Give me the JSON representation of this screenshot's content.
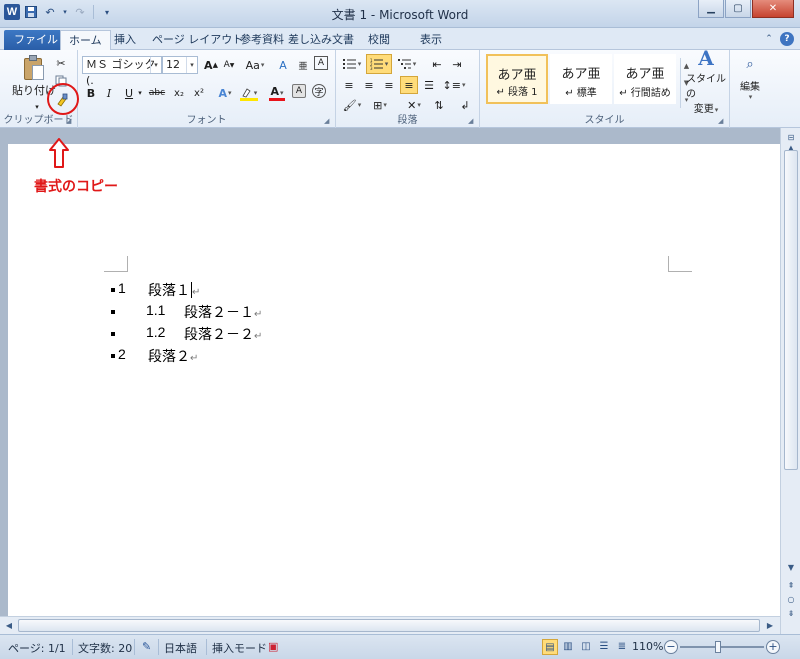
{
  "window": {
    "title": "文書 1 - Microsoft Word",
    "logo": "W"
  },
  "tabs": {
    "file": "ファイル",
    "items": [
      "ホーム",
      "挿入",
      "ページ レイアウト",
      "参考資料",
      "差し込み文書",
      "校閲",
      "表示"
    ]
  },
  "ribbon": {
    "clipboard": {
      "label": "クリップボード",
      "paste_label": "貼り付け"
    },
    "font": {
      "label": "フォント",
      "font_name": "ＭＳ ゴシック (.",
      "font_size": "12",
      "bold": "B",
      "italic": "I",
      "underline": "U",
      "strike": "abc",
      "subscript": "x₂",
      "superscript": "x²",
      "font_color": "A",
      "grow": "A",
      "shrink": "A",
      "case": "Aa",
      "clear": "A",
      "char_border": "A",
      "enclose": "字"
    },
    "paragraph": {
      "label": "段落"
    },
    "styles": {
      "label": "スタイル",
      "items": [
        {
          "sample": "あア亜",
          "name": "↵ 段落 1"
        },
        {
          "sample": "あア亜",
          "name": "↵ 標準"
        },
        {
          "sample": "あア亜",
          "name": "↵ 行間詰め"
        }
      ],
      "change_label_1": "スタイルの",
      "change_label_2": "変更"
    },
    "editing": {
      "label": "編集"
    }
  },
  "annotation": {
    "label": "書式のコピー"
  },
  "document": {
    "lines": [
      {
        "number": "1",
        "text": "段落１"
      },
      {
        "number": "1.1",
        "text": "段落２－１"
      },
      {
        "number": "1.2",
        "text": "段落２－２"
      },
      {
        "number": "2",
        "text": "段落２"
      }
    ],
    "para_mark": "↵"
  },
  "statusbar": {
    "page": "ページ: 1/1",
    "words": "文字数: 20",
    "language": "日本語",
    "mode": "挿入モード",
    "zoom": "110%"
  },
  "colors": {
    "accent": "#2b579a",
    "annotation": "#e01818",
    "highlight": "#ffe600",
    "font_color": "#e8131a"
  }
}
